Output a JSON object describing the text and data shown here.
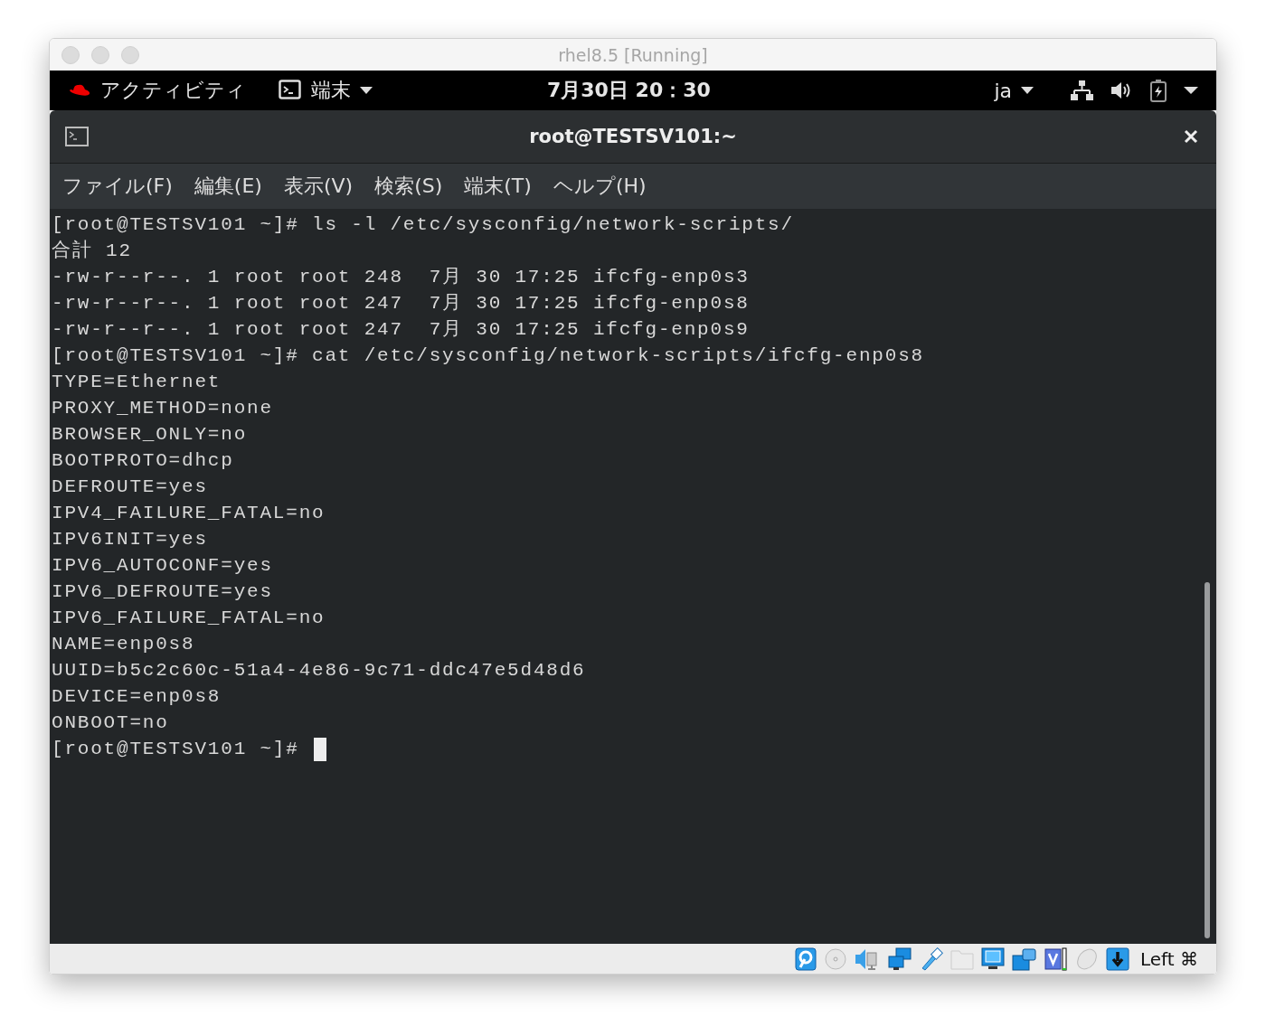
{
  "window": {
    "title": "rhel8.5 [Running]"
  },
  "top_bar": {
    "activities": "アクティビティ",
    "app_menu": "端末",
    "clock": "7月30日  20：30",
    "input_method": "ja"
  },
  "terminal": {
    "title": "root@TESTSV101:~",
    "menu": [
      "ファイル(F)",
      "編集(E)",
      "表示(V)",
      "検索(S)",
      "端末(T)",
      "ヘルプ(H)"
    ],
    "lines": [
      "[root@TESTSV101 ~]# ls -l /etc/sysconfig/network-scripts/",
      "合計 12",
      "-rw-r--r--. 1 root root 248  7月 30 17:25 ifcfg-enp0s3",
      "-rw-r--r--. 1 root root 247  7月 30 17:25 ifcfg-enp0s8",
      "-rw-r--r--. 1 root root 247  7月 30 17:25 ifcfg-enp0s9",
      "[root@TESTSV101 ~]# cat /etc/sysconfig/network-scripts/ifcfg-enp0s8",
      "TYPE=Ethernet",
      "PROXY_METHOD=none",
      "BROWSER_ONLY=no",
      "BOOTPROTO=dhcp",
      "DEFROUTE=yes",
      "IPV4_FAILURE_FATAL=no",
      "IPV6INIT=yes",
      "IPV6_AUTOCONF=yes",
      "IPV6_DEFROUTE=yes",
      "IPV6_FAILURE_FATAL=no",
      "NAME=enp0s8",
      "UUID=b5c2c60c-51a4-4e86-9c71-ddc47e5d48d6",
      "DEVICE=enp0s8",
      "ONBOOT=no"
    ],
    "prompt": "[root@TESTSV101 ~]#"
  },
  "status_bar": {
    "host_key": "Left ⌘"
  }
}
